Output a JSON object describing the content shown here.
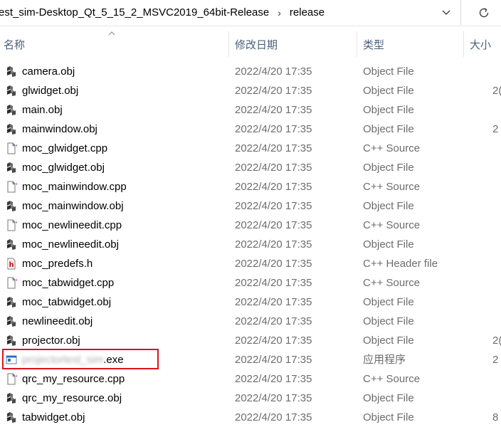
{
  "breadcrumb": {
    "segments": [
      "est_sim-Desktop_Qt_5_15_2_MSVC2019_64bit-Release",
      "release"
    ],
    "separator": "›"
  },
  "toolbar": {
    "dropdown_icon": "chevron-down-icon",
    "refresh_icon": "refresh-icon"
  },
  "columns": {
    "name": "名称",
    "date": "修改日期",
    "type": "类型",
    "size": "大小"
  },
  "files": [
    {
      "name": "camera.obj",
      "date": "2022/4/20 17:35",
      "type": "Object File",
      "size": "",
      "icon": "obj"
    },
    {
      "name": "glwidget.obj",
      "date": "2022/4/20 17:35",
      "type": "Object File",
      "size": "2(",
      "icon": "obj"
    },
    {
      "name": "main.obj",
      "date": "2022/4/20 17:35",
      "type": "Object File",
      "size": "",
      "icon": "obj"
    },
    {
      "name": "mainwindow.obj",
      "date": "2022/4/20 17:35",
      "type": "Object File",
      "size": "2",
      "icon": "obj"
    },
    {
      "name": "moc_glwidget.cpp",
      "date": "2022/4/20 17:35",
      "type": "C++ Source",
      "size": "",
      "icon": "cpp"
    },
    {
      "name": "moc_glwidget.obj",
      "date": "2022/4/20 17:35",
      "type": "Object File",
      "size": "",
      "icon": "obj"
    },
    {
      "name": "moc_mainwindow.cpp",
      "date": "2022/4/20 17:35",
      "type": "C++ Source",
      "size": "",
      "icon": "cpp"
    },
    {
      "name": "moc_mainwindow.obj",
      "date": "2022/4/20 17:35",
      "type": "Object File",
      "size": "",
      "icon": "obj"
    },
    {
      "name": "moc_newlineedit.cpp",
      "date": "2022/4/20 17:35",
      "type": "C++ Source",
      "size": "",
      "icon": "cpp"
    },
    {
      "name": "moc_newlineedit.obj",
      "date": "2022/4/20 17:35",
      "type": "Object File",
      "size": "",
      "icon": "obj"
    },
    {
      "name": "moc_predefs.h",
      "date": "2022/4/20 17:35",
      "type": "C++ Header file",
      "size": "",
      "icon": "h"
    },
    {
      "name": "moc_tabwidget.cpp",
      "date": "2022/4/20 17:35",
      "type": "C++ Source",
      "size": "",
      "icon": "cpp"
    },
    {
      "name": "moc_tabwidget.obj",
      "date": "2022/4/20 17:35",
      "type": "Object File",
      "size": "",
      "icon": "obj"
    },
    {
      "name": "newlineedit.obj",
      "date": "2022/4/20 17:35",
      "type": "Object File",
      "size": "",
      "icon": "obj"
    },
    {
      "name": "projector.obj",
      "date": "2022/4/20 17:35",
      "type": "Object File",
      "size": "2(",
      "icon": "obj"
    },
    {
      "name": "projectortest_sim",
      "ext": ".exe",
      "blurred": true,
      "date": "2022/4/20 17:35",
      "type": "应用程序",
      "size": "2",
      "icon": "exe"
    },
    {
      "name": "qrc_my_resource.cpp",
      "date": "2022/4/20 17:35",
      "type": "C++ Source",
      "size": "",
      "icon": "cpp"
    },
    {
      "name": "qrc_my_resource.obj",
      "date": "2022/4/20 17:35",
      "type": "Object File",
      "size": "",
      "icon": "obj"
    },
    {
      "name": "tabwidget.obj",
      "date": "2022/4/20 17:35",
      "type": "Object File",
      "size": "8",
      "icon": "obj"
    }
  ],
  "colors": {
    "highlight": "#d9141c",
    "header_text": "#4c607a",
    "secondary_text": "#6d6d6d"
  }
}
